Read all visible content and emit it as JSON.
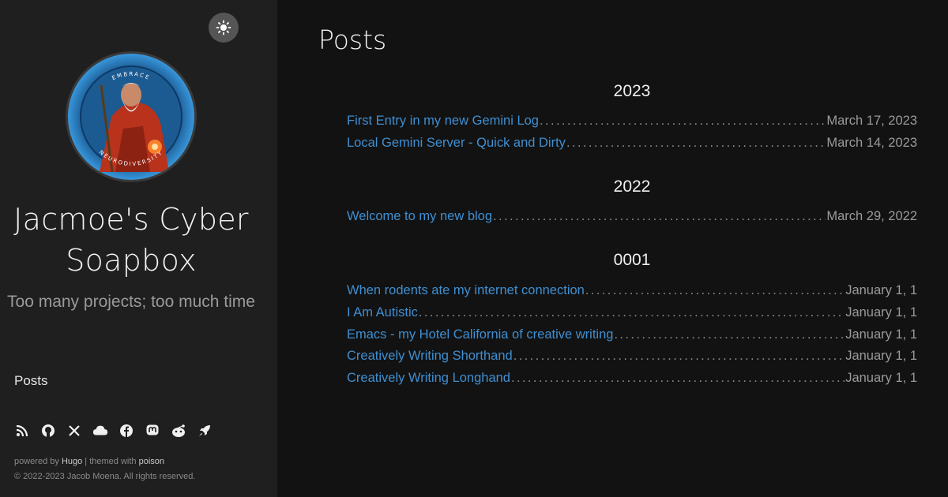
{
  "sidebar": {
    "theme_toggle_icon": "sun-icon",
    "avatar_image": "wizard-emblem",
    "avatar_text_top": "EMBRACE",
    "avatar_text_bottom": "NEURODIVERSITY",
    "site_title": "Jacmoe's Cyber Soapbox",
    "tagline": "Too many projects; too much time",
    "nav": [
      {
        "label": "Posts"
      }
    ],
    "socials": [
      "rss-icon",
      "github-icon",
      "x-icon",
      "cloud-icon",
      "facebook-icon",
      "mastodon-icon",
      "reddit-icon",
      "rocket-icon"
    ],
    "footer": {
      "powered_prefix": "powered by ",
      "hugo": "Hugo",
      "themed_prefix": " | themed with ",
      "poison": "poison",
      "copyright": "© 2022-2023 Jacob Moena. All rights reserved."
    }
  },
  "main": {
    "title": "Posts",
    "groups": [
      {
        "year": "2023",
        "posts": [
          {
            "title": "First Entry in my new Gemini Log",
            "date": "March 17, 2023"
          },
          {
            "title": "Local Gemini Server - Quick and Dirty",
            "date": "March 14, 2023"
          }
        ]
      },
      {
        "year": "2022",
        "posts": [
          {
            "title": "Welcome to my new blog",
            "date": "March 29, 2022"
          }
        ]
      },
      {
        "year": "0001",
        "posts": [
          {
            "title": "When rodents ate my internet connection",
            "date": "January 1, 1"
          },
          {
            "title": "I Am Autistic",
            "date": "January 1, 1"
          },
          {
            "title": "Emacs - my Hotel California of creative writing",
            "date": "January 1, 1"
          },
          {
            "title": "Creatively Writing Shorthand",
            "date": "January 1, 1"
          },
          {
            "title": "Creatively Writing Longhand",
            "date": "January 1, 1"
          }
        ]
      }
    ]
  },
  "colors": {
    "link": "#3f8fd2",
    "sidebar_bg": "#1f1f1f",
    "main_bg": "#121212"
  }
}
